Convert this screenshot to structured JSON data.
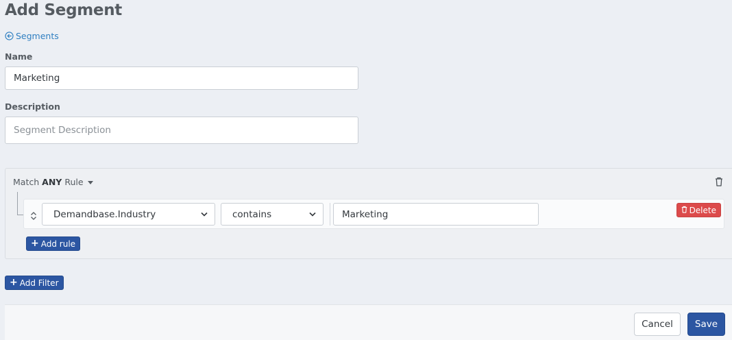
{
  "page": {
    "title": "Add Segment",
    "back_link": "Segments"
  },
  "form": {
    "name_label": "Name",
    "name_value": "Marketing",
    "description_label": "Description",
    "description_placeholder": "Segment Description"
  },
  "rule_group": {
    "match_prefix": "Match",
    "match_mode": "ANY",
    "match_suffix": "Rule",
    "rules": [
      {
        "field": "Demandbase.Industry",
        "operator": "contains",
        "value": "Marketing",
        "delete_label": "Delete"
      }
    ],
    "add_rule_label": "Add rule"
  },
  "add_filter_label": "Add Filter",
  "footer": {
    "cancel_label": "Cancel",
    "save_label": "Save"
  },
  "colors": {
    "primary": "#2c56a2",
    "danger": "#dc4b4b",
    "link": "#2f7fc1",
    "background": "#eceff4"
  },
  "icons": [
    "back-circle-arrow-icon",
    "trash-icon",
    "sort-handle-icon",
    "chevron-down-icon",
    "plus-icon",
    "caret-down-icon"
  ]
}
